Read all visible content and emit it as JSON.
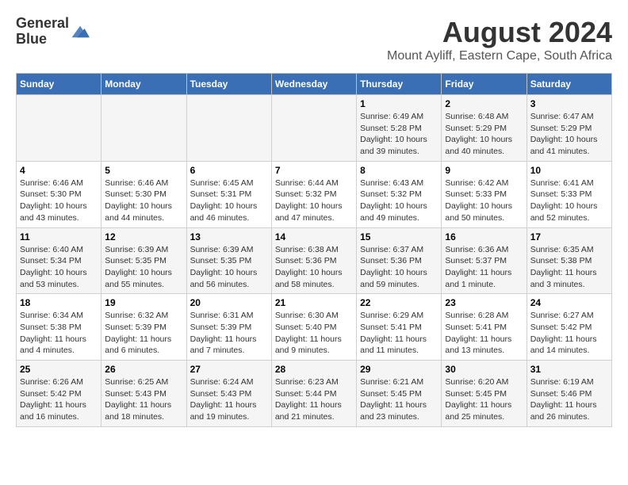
{
  "header": {
    "logo_general": "General",
    "logo_blue": "Blue",
    "main_title": "August 2024",
    "sub_title": "Mount Ayliff, Eastern Cape, South Africa"
  },
  "days_of_week": [
    "Sunday",
    "Monday",
    "Tuesday",
    "Wednesday",
    "Thursday",
    "Friday",
    "Saturday"
  ],
  "weeks": [
    [
      {
        "day": "",
        "info": ""
      },
      {
        "day": "",
        "info": ""
      },
      {
        "day": "",
        "info": ""
      },
      {
        "day": "",
        "info": ""
      },
      {
        "day": "1",
        "info": "Sunrise: 6:49 AM\nSunset: 5:28 PM\nDaylight: 10 hours\nand 39 minutes."
      },
      {
        "day": "2",
        "info": "Sunrise: 6:48 AM\nSunset: 5:29 PM\nDaylight: 10 hours\nand 40 minutes."
      },
      {
        "day": "3",
        "info": "Sunrise: 6:47 AM\nSunset: 5:29 PM\nDaylight: 10 hours\nand 41 minutes."
      }
    ],
    [
      {
        "day": "4",
        "info": "Sunrise: 6:46 AM\nSunset: 5:30 PM\nDaylight: 10 hours\nand 43 minutes."
      },
      {
        "day": "5",
        "info": "Sunrise: 6:46 AM\nSunset: 5:30 PM\nDaylight: 10 hours\nand 44 minutes."
      },
      {
        "day": "6",
        "info": "Sunrise: 6:45 AM\nSunset: 5:31 PM\nDaylight: 10 hours\nand 46 minutes."
      },
      {
        "day": "7",
        "info": "Sunrise: 6:44 AM\nSunset: 5:32 PM\nDaylight: 10 hours\nand 47 minutes."
      },
      {
        "day": "8",
        "info": "Sunrise: 6:43 AM\nSunset: 5:32 PM\nDaylight: 10 hours\nand 49 minutes."
      },
      {
        "day": "9",
        "info": "Sunrise: 6:42 AM\nSunset: 5:33 PM\nDaylight: 10 hours\nand 50 minutes."
      },
      {
        "day": "10",
        "info": "Sunrise: 6:41 AM\nSunset: 5:33 PM\nDaylight: 10 hours\nand 52 minutes."
      }
    ],
    [
      {
        "day": "11",
        "info": "Sunrise: 6:40 AM\nSunset: 5:34 PM\nDaylight: 10 hours\nand 53 minutes."
      },
      {
        "day": "12",
        "info": "Sunrise: 6:39 AM\nSunset: 5:35 PM\nDaylight: 10 hours\nand 55 minutes."
      },
      {
        "day": "13",
        "info": "Sunrise: 6:39 AM\nSunset: 5:35 PM\nDaylight: 10 hours\nand 56 minutes."
      },
      {
        "day": "14",
        "info": "Sunrise: 6:38 AM\nSunset: 5:36 PM\nDaylight: 10 hours\nand 58 minutes."
      },
      {
        "day": "15",
        "info": "Sunrise: 6:37 AM\nSunset: 5:36 PM\nDaylight: 10 hours\nand 59 minutes."
      },
      {
        "day": "16",
        "info": "Sunrise: 6:36 AM\nSunset: 5:37 PM\nDaylight: 11 hours\nand 1 minute."
      },
      {
        "day": "17",
        "info": "Sunrise: 6:35 AM\nSunset: 5:38 PM\nDaylight: 11 hours\nand 3 minutes."
      }
    ],
    [
      {
        "day": "18",
        "info": "Sunrise: 6:34 AM\nSunset: 5:38 PM\nDaylight: 11 hours\nand 4 minutes."
      },
      {
        "day": "19",
        "info": "Sunrise: 6:32 AM\nSunset: 5:39 PM\nDaylight: 11 hours\nand 6 minutes."
      },
      {
        "day": "20",
        "info": "Sunrise: 6:31 AM\nSunset: 5:39 PM\nDaylight: 11 hours\nand 7 minutes."
      },
      {
        "day": "21",
        "info": "Sunrise: 6:30 AM\nSunset: 5:40 PM\nDaylight: 11 hours\nand 9 minutes."
      },
      {
        "day": "22",
        "info": "Sunrise: 6:29 AM\nSunset: 5:41 PM\nDaylight: 11 hours\nand 11 minutes."
      },
      {
        "day": "23",
        "info": "Sunrise: 6:28 AM\nSunset: 5:41 PM\nDaylight: 11 hours\nand 13 minutes."
      },
      {
        "day": "24",
        "info": "Sunrise: 6:27 AM\nSunset: 5:42 PM\nDaylight: 11 hours\nand 14 minutes."
      }
    ],
    [
      {
        "day": "25",
        "info": "Sunrise: 6:26 AM\nSunset: 5:42 PM\nDaylight: 11 hours\nand 16 minutes."
      },
      {
        "day": "26",
        "info": "Sunrise: 6:25 AM\nSunset: 5:43 PM\nDaylight: 11 hours\nand 18 minutes."
      },
      {
        "day": "27",
        "info": "Sunrise: 6:24 AM\nSunset: 5:43 PM\nDaylight: 11 hours\nand 19 minutes."
      },
      {
        "day": "28",
        "info": "Sunrise: 6:23 AM\nSunset: 5:44 PM\nDaylight: 11 hours\nand 21 minutes."
      },
      {
        "day": "29",
        "info": "Sunrise: 6:21 AM\nSunset: 5:45 PM\nDaylight: 11 hours\nand 23 minutes."
      },
      {
        "day": "30",
        "info": "Sunrise: 6:20 AM\nSunset: 5:45 PM\nDaylight: 11 hours\nand 25 minutes."
      },
      {
        "day": "31",
        "info": "Sunrise: 6:19 AM\nSunset: 5:46 PM\nDaylight: 11 hours\nand 26 minutes."
      }
    ]
  ]
}
